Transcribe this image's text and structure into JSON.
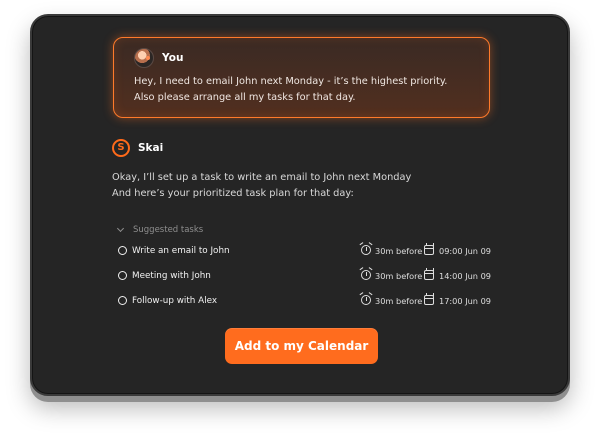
{
  "conversation": {
    "user": {
      "name": "You",
      "message_lines": [
        "Hey, I need to email John next Monday - it’s the highest priority.",
        "Also please arrange all my tasks for that day."
      ]
    },
    "assistant": {
      "name": "Skai",
      "logo_letter": "S",
      "message_lines": [
        "Okay, I’ll set up a task to write an email to John next Monday",
        "And here’s your prioritized task plan for that day:"
      ]
    }
  },
  "suggested_tasks": {
    "label": "Suggested tasks",
    "items": [
      {
        "title": "Write an email to John",
        "reminder": "30m before",
        "time": "09:00 Jun 09"
      },
      {
        "title": "Meeting with John",
        "reminder": "30m before",
        "time": "14:00 Jun 09"
      },
      {
        "title": "Follow-up with Alex",
        "reminder": "30m before",
        "time": "17:00 Jun 09"
      }
    ]
  },
  "actions": {
    "add_to_calendar": "Add to my Calendar"
  },
  "colors": {
    "accent": "#ff6c1e",
    "window_bg": "#252525",
    "user_card_border": "#ff7a2a"
  }
}
